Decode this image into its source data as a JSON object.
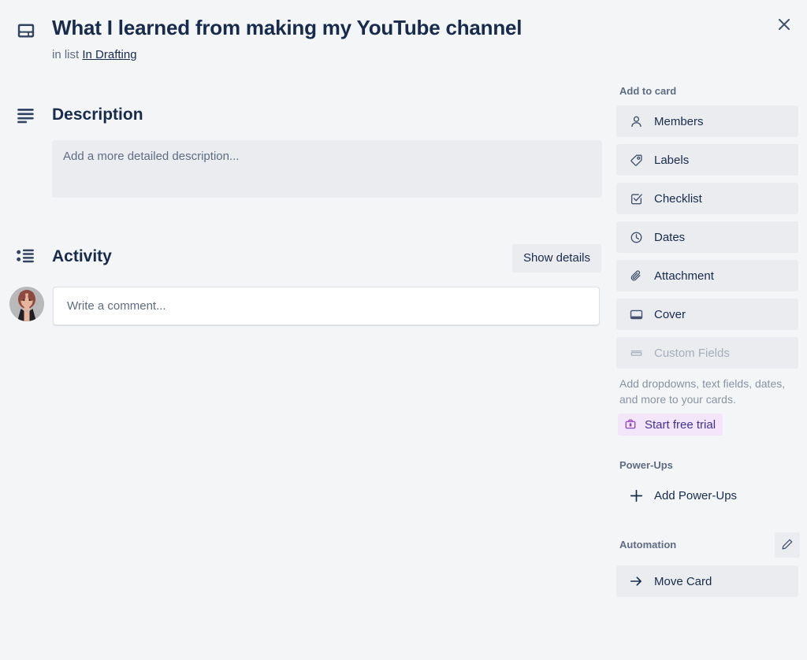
{
  "window": {
    "close_label": "Close",
    "close_icon": "close-icon"
  },
  "card": {
    "header_icon": "card-cover-icon",
    "title": "What I learned from making my YouTube channel",
    "in_list_prefix": "in list",
    "list_name": "In Drafting"
  },
  "description": {
    "icon": "description-lines-icon",
    "heading": "Description",
    "placeholder": "Add a more detailed description..."
  },
  "activity": {
    "icon": "activity-list-icon",
    "heading": "Activity",
    "show_details_label": "Show details",
    "avatar_icon": "user-avatar-photo",
    "comment_placeholder": "Write a comment..."
  },
  "sidebar": {
    "add_to_card": {
      "heading": "Add to card",
      "items": [
        {
          "label": "Members",
          "icon": "person-icon",
          "disabled": false
        },
        {
          "label": "Labels",
          "icon": "label-tag-icon",
          "disabled": false
        },
        {
          "label": "Checklist",
          "icon": "checkbox-icon",
          "disabled": false
        },
        {
          "label": "Dates",
          "icon": "clock-icon",
          "disabled": false
        },
        {
          "label": "Attachment",
          "icon": "paperclip-icon",
          "disabled": false
        },
        {
          "label": "Cover",
          "icon": "cover-icon",
          "disabled": false
        },
        {
          "label": "Custom Fields",
          "icon": "custom-fields-icon",
          "disabled": true
        }
      ],
      "note": "Add dropdowns, text fields, dates, and more to your cards.",
      "trial_label": "Start free trial",
      "trial_icon": "briefcase-icon",
      "trial_bg": "#f3e6fb",
      "trial_fg": "#403294"
    },
    "power_ups": {
      "heading": "Power-Ups",
      "add_label": "Add Power-Ups",
      "add_icon": "plus-icon"
    },
    "automation": {
      "heading": "Automation",
      "edit_icon": "pencil-icon",
      "items": [
        {
          "label": "Move Card",
          "icon": "arrow-right-icon"
        }
      ]
    }
  },
  "colors": {
    "page_bg": "#f4f5f7",
    "text": "#172b4d",
    "muted": "#5e6c84",
    "button_bg": "#ebecf0",
    "disabled": "#a5adba"
  }
}
